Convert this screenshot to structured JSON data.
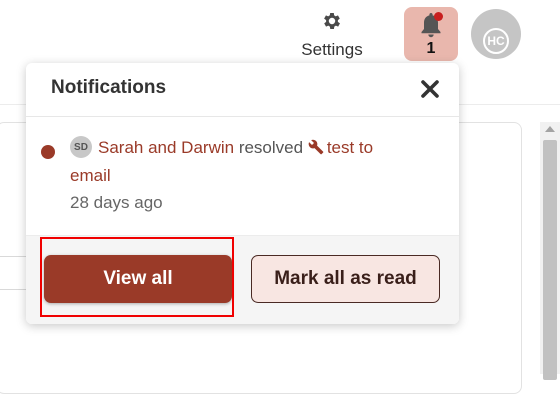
{
  "header": {
    "settings_label": "Settings",
    "settings_icon": "gear-icon",
    "notifications_count": "1",
    "bell_icon": "bell-icon",
    "avatar_initials": "HC"
  },
  "popup": {
    "title": "Notifications",
    "close_icon": "close-icon",
    "notification": {
      "avatar_initials": "SD",
      "actor": "Sarah and Darwin",
      "action": "resolved",
      "target_icon": "wrench-icon",
      "target": "test to email",
      "time": "28 days ago",
      "unread": true
    },
    "view_all_label": "View all",
    "mark_all_label": "Mark all as read"
  },
  "colors": {
    "accent": "#9a3a28",
    "bell_bg": "#e9b7ad",
    "badge_dot": "#c81e1e",
    "mark_all_bg": "#f8e6e2",
    "highlight": "#f00000"
  }
}
